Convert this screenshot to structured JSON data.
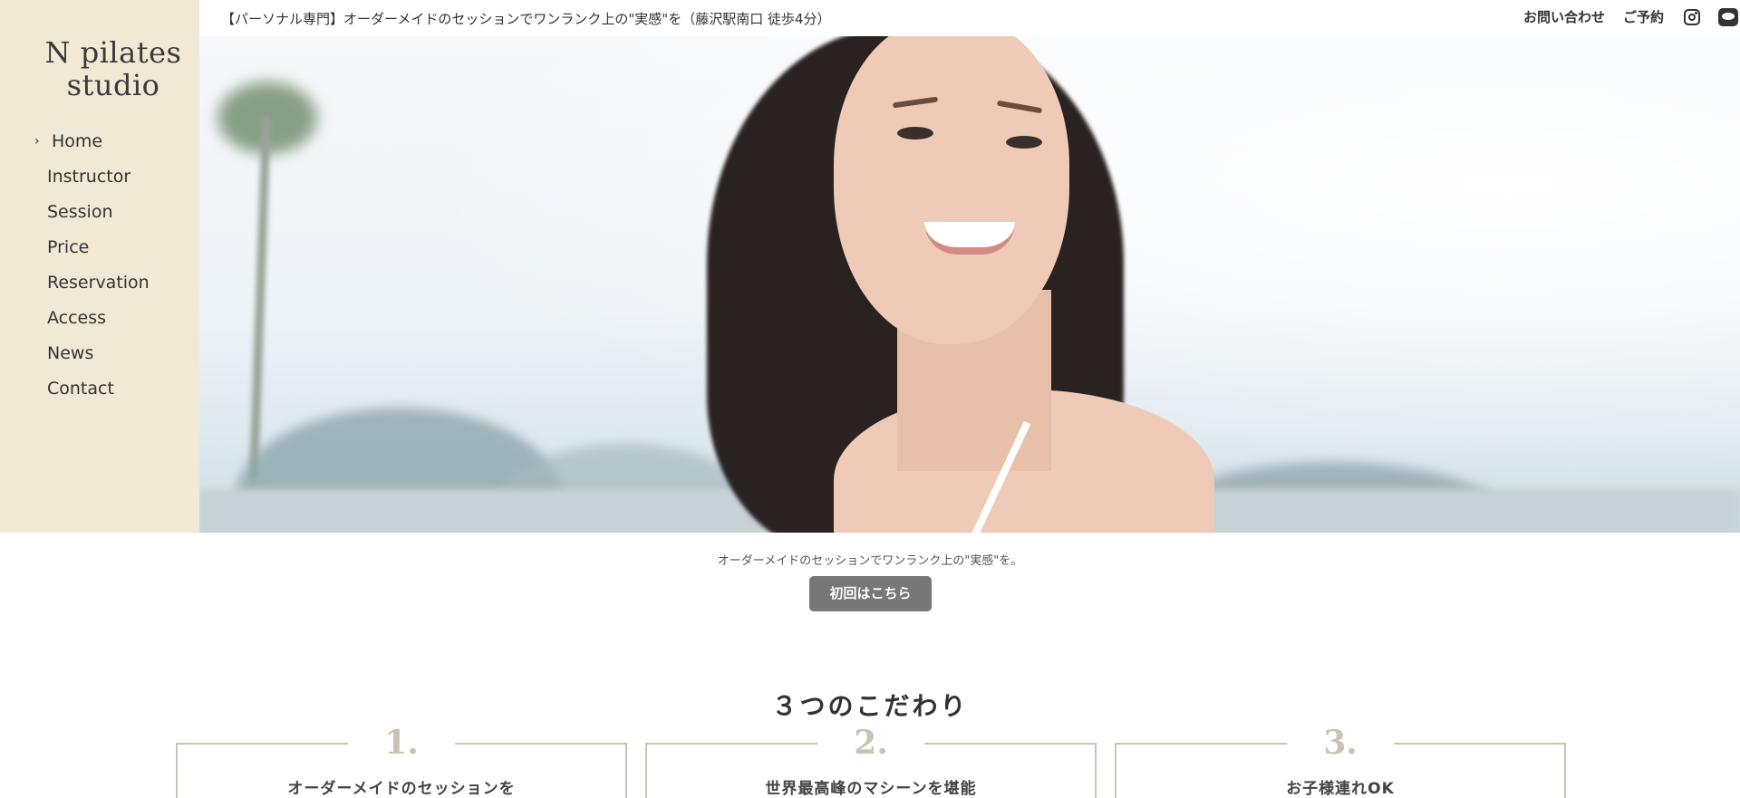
{
  "brand": {
    "logo_line1": "N pilates",
    "logo_line2": "studio"
  },
  "nav": {
    "items": [
      {
        "label": "Home",
        "active": true
      },
      {
        "label": "Instructor"
      },
      {
        "label": "Session"
      },
      {
        "label": "Price"
      },
      {
        "label": "Reservation"
      },
      {
        "label": "Access"
      },
      {
        "label": "News"
      },
      {
        "label": "Contact"
      }
    ],
    "active_marker": "›"
  },
  "header": {
    "tagline": "【パーソナル専門】オーダーメイドのセッションでワンランク上の\"実感\"を（藤沢駅南口 徒歩4分）",
    "contact_link": "お問い合わせ",
    "reserve_link": "ご予約",
    "icons": [
      "instagram-icon",
      "line-icon"
    ]
  },
  "hero": {
    "image": "smiling-woman-photo"
  },
  "intro": {
    "subtext": "オーダーメイドのセッションでワンランク上の\"実感\"を。",
    "cta_label": "初回はこちら"
  },
  "features": {
    "title": "３つのこだわり",
    "cards": [
      {
        "number": "1.",
        "text": "オーダーメイドのセッションを"
      },
      {
        "number": "2.",
        "text": "世界最高峰のマシーンを堪能"
      },
      {
        "number": "3.",
        "text": "お子様連れOK"
      }
    ]
  },
  "colors": {
    "sidebar_bg": "#f2e8d6",
    "cta_bg": "#777777",
    "accent": "#c9c3b3"
  }
}
